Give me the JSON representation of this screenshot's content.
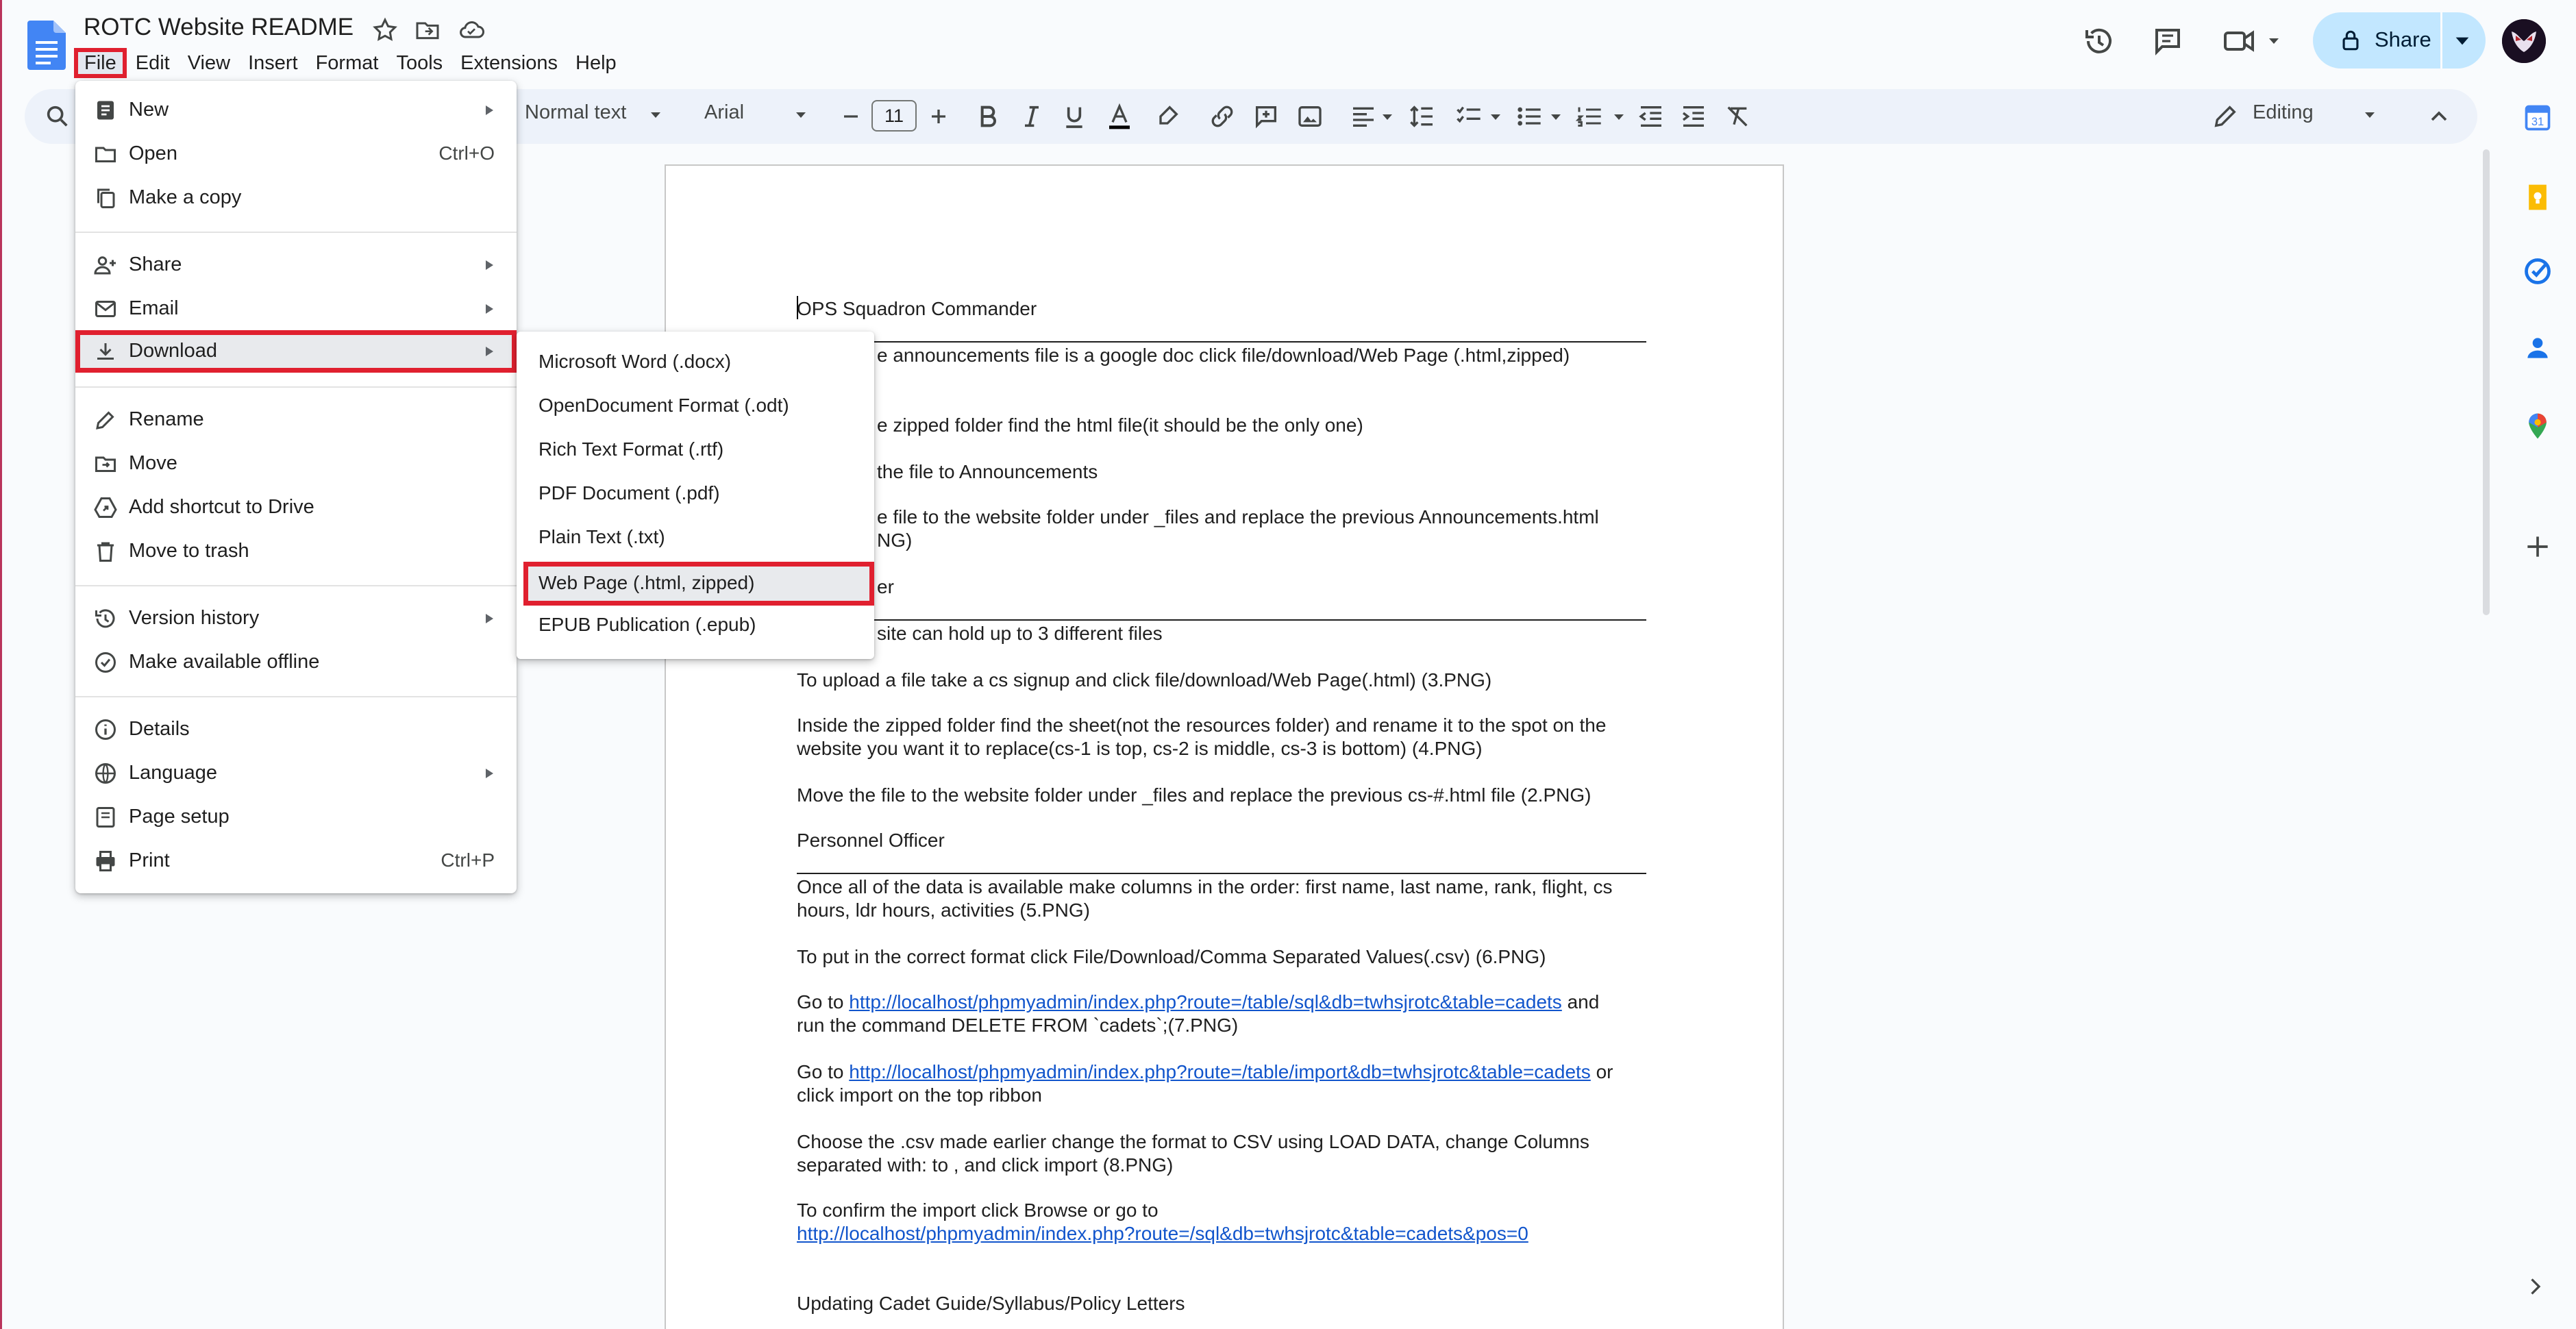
{
  "doc_title": "ROTC Website README",
  "menubar": [
    "File",
    "Edit",
    "View",
    "Insert",
    "Format",
    "Tools",
    "Extensions",
    "Help"
  ],
  "share_label": "Share",
  "toolbar": {
    "style": "Normal text",
    "font": "Arial",
    "font_size": "11",
    "mode": "Editing"
  },
  "file_menu": {
    "items": [
      {
        "label": "New",
        "icon": "new-doc-icon",
        "shortcut": "",
        "submenu": true
      },
      {
        "label": "Open",
        "icon": "folder-open-icon",
        "shortcut": "Ctrl+O",
        "submenu": false
      },
      {
        "label": "Make a copy",
        "icon": "copy-icon",
        "shortcut": "",
        "submenu": false
      },
      {
        "label": "Share",
        "icon": "person-add-icon",
        "shortcut": "",
        "submenu": true
      },
      {
        "label": "Email",
        "icon": "email-icon",
        "shortcut": "",
        "submenu": true
      },
      {
        "label": "Download",
        "icon": "download-icon",
        "shortcut": "",
        "submenu": true
      },
      {
        "label": "Rename",
        "icon": "rename-icon",
        "shortcut": "",
        "submenu": false
      },
      {
        "label": "Move",
        "icon": "move-icon",
        "shortcut": "",
        "submenu": false
      },
      {
        "label": "Add shortcut to Drive",
        "icon": "drive-shortcut-icon",
        "shortcut": "",
        "submenu": false
      },
      {
        "label": "Move to trash",
        "icon": "trash-icon",
        "shortcut": "",
        "submenu": false
      },
      {
        "label": "Version history",
        "icon": "history-icon",
        "shortcut": "",
        "submenu": true
      },
      {
        "label": "Make available offline",
        "icon": "offline-icon",
        "shortcut": "",
        "submenu": false
      },
      {
        "label": "Details",
        "icon": "info-icon",
        "shortcut": "",
        "submenu": false
      },
      {
        "label": "Language",
        "icon": "globe-icon",
        "shortcut": "",
        "submenu": true
      },
      {
        "label": "Page setup",
        "icon": "page-setup-icon",
        "shortcut": "",
        "submenu": false
      },
      {
        "label": "Print",
        "icon": "print-icon",
        "shortcut": "Ctrl+P",
        "submenu": false
      }
    ]
  },
  "download_menu": {
    "items": [
      "Microsoft Word (.docx)",
      "OpenDocument Format (.odt)",
      "Rich Text Format (.rtf)",
      "PDF Document (.pdf)",
      "Plain Text (.txt)",
      "Web Page (.html, zipped)",
      "EPUB Publication (.epub)"
    ]
  },
  "document": {
    "lines": [
      "OPS Squadron Commander",
      "e announcements file is a google doc click file/download/Web Page (.html,zipped)",
      "e zipped folder find the html file(it should be the only one)",
      "the file to Announcements",
      "e file to the website folder under _files and replace the previous Announcements.html",
      "NG)",
      "er",
      "site can hold up to 3 different files",
      "To upload a file take a cs signup and click file/download/Web Page(.html) (3.PNG)",
      "Inside the zipped folder find the sheet(not the resources folder) and rename it to the spot on the",
      "website you want it to replace(cs-1 is top, cs-2 is middle, cs-3 is bottom) (4.PNG)",
      "Move the file to the website folder under _files and replace the previous cs-#.html file (2.PNG)",
      "Personnel Officer",
      "Once all of the data is available make columns in the order: first name, last name, rank, flight, cs",
      "hours, ldr hours, activities (5.PNG)",
      "To put in the correct format click File/Download/Comma Separated Values(.csv) (6.PNG)",
      "Go to",
      "http://localhost/phpmyadmin/index.php?route=/table/sql&db=twhsjrotc&table=cadets",
      "and",
      "run the command DELETE FROM `cadets`;(7.PNG)",
      "Go to",
      "http://localhost/phpmyadmin/index.php?route=/table/import&db=twhsjrotc&table=cadets",
      "or",
      "click import on the top ribbon",
      "Choose the .csv made earlier change the format to CSV using LOAD DATA, change Columns",
      "separated with: to , and click import (8.PNG)",
      "To confirm the import click Browse or go to",
      "http://localhost/phpmyadmin/index.php?route=/sql&db=twhsjrotc&table=cadets&pos=0",
      "Updating Cadet Guide/Syllabus/Policy Letters"
    ]
  },
  "colors": {
    "highlight_red": "#e0202f",
    "share_bg": "#c2e7ff",
    "toolbar_bg": "#edf2fa",
    "link": "#1155cc",
    "docs_blue": "#4285f4"
  }
}
